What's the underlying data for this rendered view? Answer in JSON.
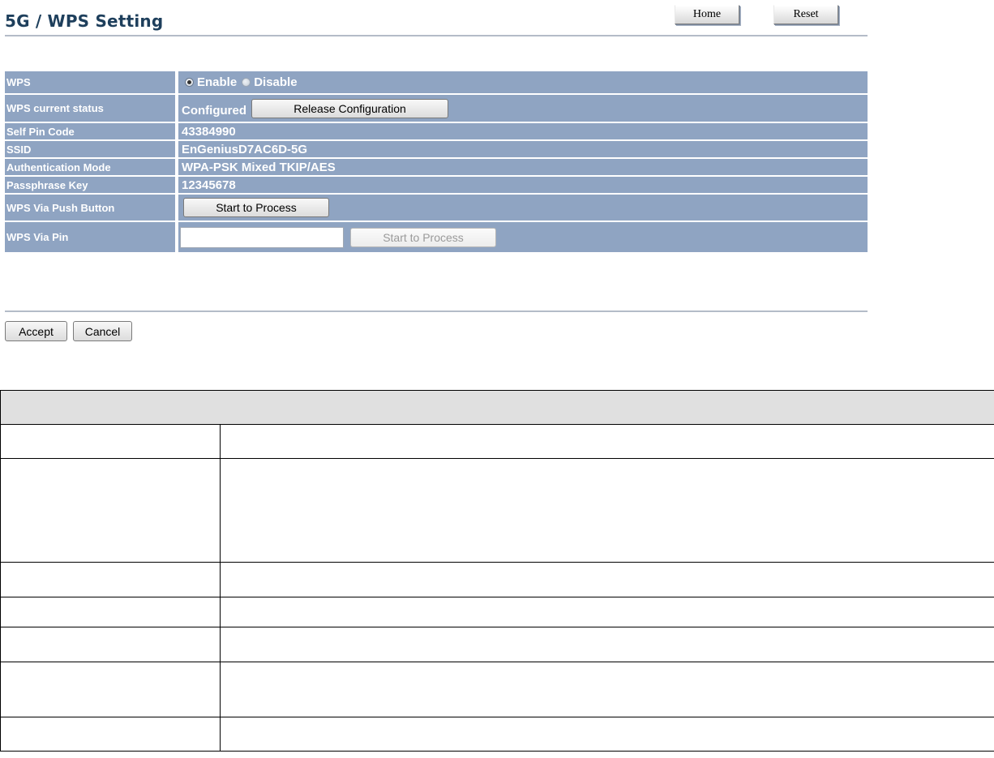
{
  "header": {
    "title": "5G / WPS Setting",
    "home_label": "Home",
    "reset_label": "Reset"
  },
  "settings": {
    "wps": {
      "label": "WPS",
      "options": [
        "Enable",
        "Disable"
      ],
      "selected": "Enable"
    },
    "status": {
      "label": "WPS current status",
      "value": "Configured",
      "button": "Release Configuration"
    },
    "self_pin": {
      "label": "Self Pin Code",
      "value": "43384990"
    },
    "ssid": {
      "label": "SSID",
      "value": "EnGeniusD7AC6D-5G"
    },
    "auth_mode": {
      "label": "Authentication Mode",
      "value": "WPA-PSK Mixed TKIP/AES"
    },
    "passphrase": {
      "label": "Passphrase Key",
      "value": "12345678"
    },
    "push_button": {
      "label": "WPS Via Push Button",
      "button": "Start to Process"
    },
    "via_pin": {
      "label": "WPS Via Pin",
      "input_value": "",
      "button": "Start to Process"
    }
  },
  "footer": {
    "accept_label": "Accept",
    "cancel_label": "Cancel"
  },
  "colors": {
    "row_background": "#8fa4c2",
    "title_text": "#1e3f5c",
    "divider": "#b4bcc8"
  }
}
